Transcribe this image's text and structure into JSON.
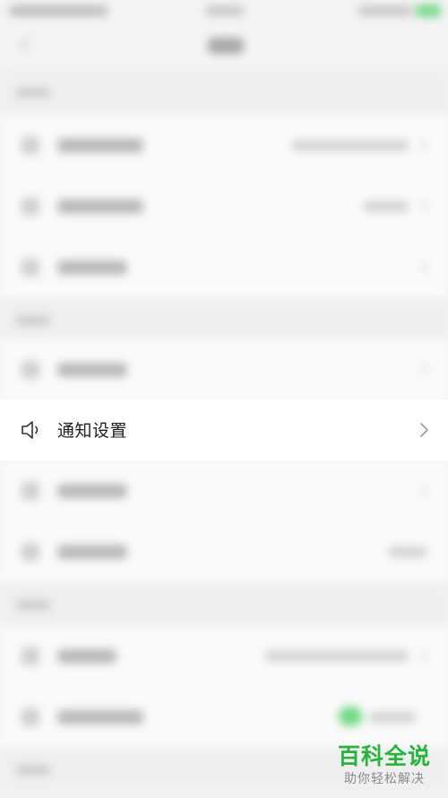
{
  "notification_settings": {
    "label": "通知设置",
    "icon": "speaker-icon",
    "chevron": "chevron-right-icon"
  },
  "watermark": {
    "brand": "百科全说",
    "tagline": "助你轻松解决",
    "brand_color": "#27b43b"
  },
  "colors": {
    "background": "#f4f4f4",
    "highlight_row": "#ffffff",
    "text": "#1e1e1e",
    "toggle_on": "#6fd983"
  }
}
